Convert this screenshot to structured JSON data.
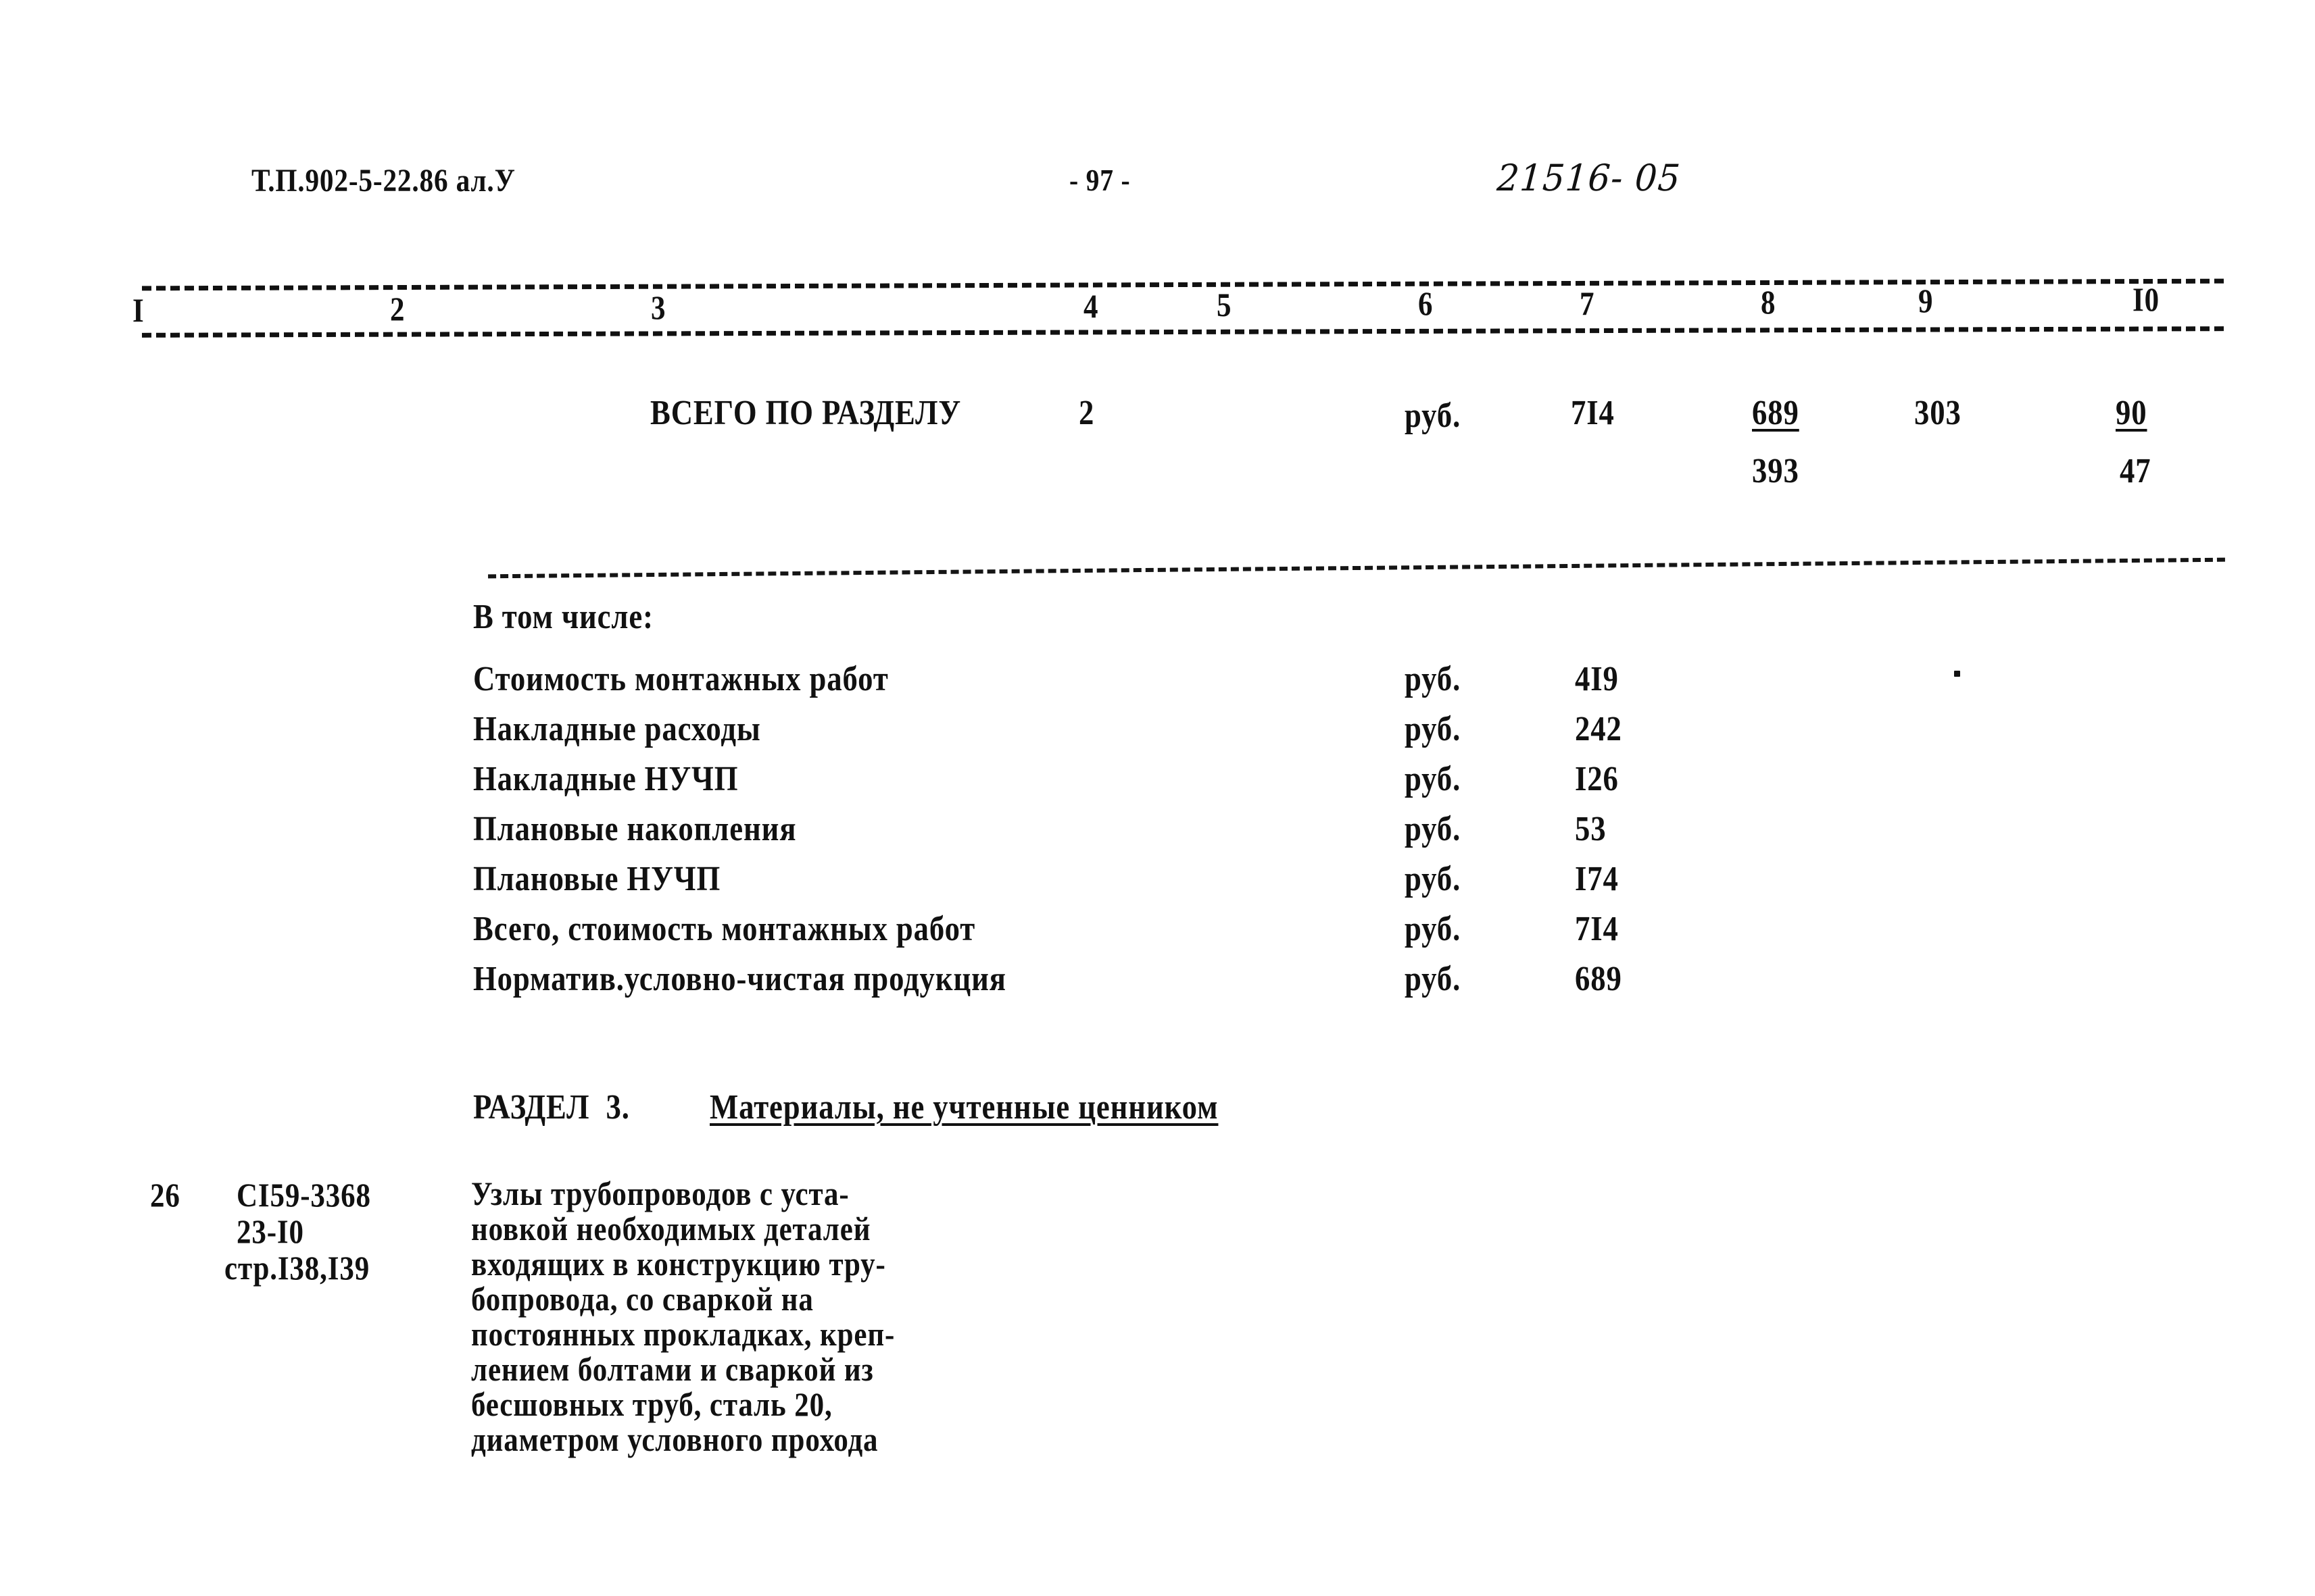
{
  "header": {
    "document_code": "Т.П.902-5-22.86 ал.У",
    "page_marker": "- 97 -",
    "handwritten_note": "21516- 05"
  },
  "table": {
    "column_numbers": [
      "I",
      "2",
      "3",
      "4",
      "5",
      "6",
      "7",
      "8",
      "9",
      "I0"
    ],
    "total_row": {
      "label": "ВСЕГО ПО РАЗДЕЛУ",
      "col4": "2",
      "unit": "руб.",
      "col7": "7I4",
      "col8_top": "689",
      "col8_bottom": "393",
      "col9": "303",
      "col10_top": "90",
      "col10_bottom": "47"
    },
    "breakdown_heading": "В том числе:",
    "breakdown_rows": [
      {
        "label": "Стоимость монтажных работ",
        "unit": "руб.",
        "value": "4I9"
      },
      {
        "label": "Накладные расходы",
        "unit": "руб.",
        "value": "242"
      },
      {
        "label": "Накладные НУЧП",
        "unit": "руб.",
        "value": "I26"
      },
      {
        "label": "Плановые накопления",
        "unit": "руб.",
        "value": "53"
      },
      {
        "label": "Плановые НУЧП",
        "unit": "руб.",
        "value": "I74"
      },
      {
        "label": "Всего, стоимость монтажных работ",
        "unit": "руб.",
        "value": "7I4"
      },
      {
        "label": "Норматив.условно-чистая продукция",
        "unit": "руб.",
        "value": "689"
      }
    ]
  },
  "section": {
    "number_label": "РАЗДЕЛ  3.",
    "title": "Материалы, не учтенные ценником"
  },
  "entry": {
    "index": "26",
    "code_lines": [
      "СI59-3368",
      "23-I0",
      "стр.I38,I39"
    ],
    "description_lines": [
      "Узлы трубопроводов с уста-",
      "новкой необходимых деталей",
      "входящих в конструкцию тру-",
      "бопровода, со сваркой на",
      "постоянных прокладках, креп-",
      "лением болтами и сваркой из",
      "бесшовных труб, сталь 20,",
      "диаметром условного прохода"
    ]
  }
}
